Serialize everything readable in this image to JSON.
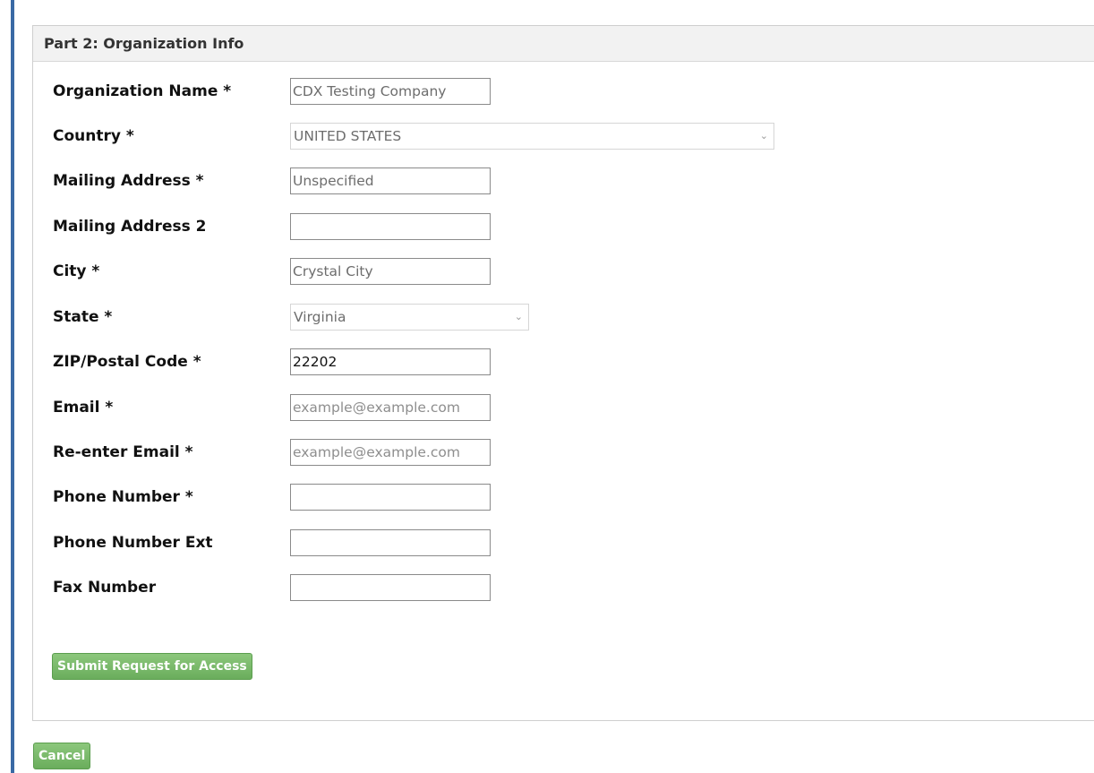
{
  "panel": {
    "title": "Part 2: Organization Info"
  },
  "fields": {
    "org_name": {
      "label": "Organization Name *",
      "value": "CDX Testing Company"
    },
    "country": {
      "label": "Country *",
      "value": "UNITED STATES"
    },
    "mailing_address": {
      "label": "Mailing Address *",
      "value": "Unspecified"
    },
    "mailing_address_2": {
      "label": "Mailing Address 2",
      "value": ""
    },
    "city": {
      "label": "City *",
      "value": "Crystal City"
    },
    "state": {
      "label": "State *",
      "value": "Virginia"
    },
    "zip": {
      "label": "ZIP/Postal Code *",
      "value": "22202"
    },
    "email": {
      "label": "Email *",
      "value": "",
      "placeholder": "example@example.com"
    },
    "reenter_email": {
      "label": "Re-enter Email *",
      "value": "",
      "placeholder": "example@example.com"
    },
    "phone": {
      "label": "Phone Number *",
      "value": ""
    },
    "phone_ext": {
      "label": "Phone Number Ext",
      "value": ""
    },
    "fax": {
      "label": "Fax Number",
      "value": ""
    }
  },
  "buttons": {
    "submit_label": "Submit Request for Access",
    "cancel_label": "Cancel"
  },
  "colors": {
    "accent_bar": "#3a6aa5",
    "button_green": "#6aad5c"
  }
}
